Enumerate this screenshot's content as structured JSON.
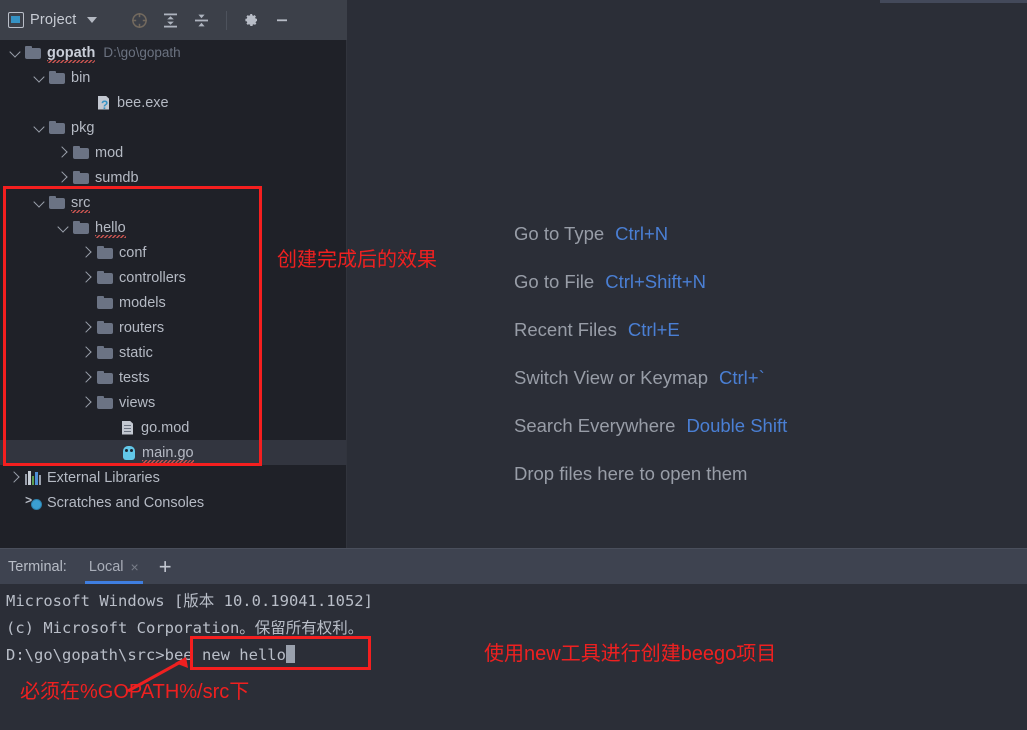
{
  "toolwindow": {
    "title": "Project",
    "icons": [
      {
        "name": "project-view-icon",
        "glyph": "project"
      },
      {
        "name": "dropdown-caret-icon",
        "glyph": "caret-down"
      },
      {
        "name": "scroll-from-source-icon",
        "glyph": "crosshair-target"
      },
      {
        "name": "expand-all-icon",
        "glyph": "expand-all"
      },
      {
        "name": "collapse-all-icon",
        "glyph": "collapse-all"
      },
      {
        "name": "settings-gear-icon",
        "glyph": "gear"
      },
      {
        "name": "hide-toolwindow-icon",
        "glyph": "minus"
      }
    ]
  },
  "tree": {
    "nodes": [
      {
        "label": "gopath",
        "path": "D:\\go\\gopath",
        "indent": 0,
        "toggle": "open",
        "icon": "folder",
        "bold": true,
        "squiggle": true,
        "selected": false
      },
      {
        "label": "bin",
        "path": "",
        "indent": 1,
        "toggle": "open",
        "icon": "folder",
        "bold": false,
        "squiggle": false,
        "selected": false
      },
      {
        "label": "bee.exe",
        "path": "",
        "indent": 3,
        "toggle": "none",
        "icon": "exe",
        "bold": false,
        "squiggle": false,
        "selected": false
      },
      {
        "label": "pkg",
        "path": "",
        "indent": 1,
        "toggle": "open",
        "icon": "folder",
        "bold": false,
        "squiggle": false,
        "selected": false
      },
      {
        "label": "mod",
        "path": "",
        "indent": 2,
        "toggle": "closed",
        "icon": "folder",
        "bold": false,
        "squiggle": false,
        "selected": false
      },
      {
        "label": "sumdb",
        "path": "",
        "indent": 2,
        "toggle": "closed",
        "icon": "folder",
        "bold": false,
        "squiggle": false,
        "selected": false
      },
      {
        "label": "src",
        "path": "",
        "indent": 1,
        "toggle": "open",
        "icon": "folder",
        "bold": false,
        "squiggle": true,
        "selected": false
      },
      {
        "label": "hello",
        "path": "",
        "indent": 2,
        "toggle": "open",
        "icon": "folder",
        "bold": false,
        "squiggle": true,
        "selected": false
      },
      {
        "label": "conf",
        "path": "",
        "indent": 3,
        "toggle": "closed",
        "icon": "folder",
        "bold": false,
        "squiggle": false,
        "selected": false
      },
      {
        "label": "controllers",
        "path": "",
        "indent": 3,
        "toggle": "closed",
        "icon": "folder",
        "bold": false,
        "squiggle": false,
        "selected": false
      },
      {
        "label": "models",
        "path": "",
        "indent": 3,
        "toggle": "none",
        "icon": "folder",
        "bold": false,
        "squiggle": false,
        "selected": false
      },
      {
        "label": "routers",
        "path": "",
        "indent": 3,
        "toggle": "closed",
        "icon": "folder",
        "bold": false,
        "squiggle": false,
        "selected": false
      },
      {
        "label": "static",
        "path": "",
        "indent": 3,
        "toggle": "closed",
        "icon": "folder",
        "bold": false,
        "squiggle": false,
        "selected": false
      },
      {
        "label": "tests",
        "path": "",
        "indent": 3,
        "toggle": "closed",
        "icon": "folder",
        "bold": false,
        "squiggle": false,
        "selected": false
      },
      {
        "label": "views",
        "path": "",
        "indent": 3,
        "toggle": "closed",
        "icon": "folder",
        "bold": false,
        "squiggle": false,
        "selected": false
      },
      {
        "label": "go.mod",
        "path": "",
        "indent": 4,
        "toggle": "none",
        "icon": "doc",
        "bold": false,
        "squiggle": false,
        "selected": false
      },
      {
        "label": "main.go",
        "path": "",
        "indent": 4,
        "toggle": "none",
        "icon": "gopher",
        "bold": false,
        "squiggle": true,
        "selected": true
      },
      {
        "label": "External Libraries",
        "path": "",
        "indent": 0,
        "toggle": "closed",
        "icon": "library",
        "bold": false,
        "squiggle": false,
        "selected": false
      },
      {
        "label": "Scratches and Consoles",
        "path": "",
        "indent": 0,
        "toggle": "none",
        "icon": "scratch",
        "bold": false,
        "squiggle": false,
        "selected": false
      }
    ]
  },
  "editor_hints": [
    {
      "action": "Go to Type",
      "key": "Ctrl+N"
    },
    {
      "action": "Go to File",
      "key": "Ctrl+Shift+N"
    },
    {
      "action": "Recent Files",
      "key": "Ctrl+E"
    },
    {
      "action": "Switch View or Keymap",
      "key": "Ctrl+`"
    },
    {
      "action": "Search Everywhere",
      "key": "Double Shift"
    },
    {
      "action": "Drop files here to open them",
      "key": ""
    }
  ],
  "terminal": {
    "label": "Terminal:",
    "tab_name": "Local",
    "tab_close": "×",
    "add_tab": "+",
    "lines": [
      "Microsoft Windows [版本 10.0.19041.1052]",
      "(c) Microsoft Corporation。保留所有权利。"
    ],
    "prompt": "D:\\go\\gopath\\src>",
    "command": "bee new hello"
  },
  "annotations": {
    "tree_note": "创建完成后的效果",
    "command_note": "使用new工具进行创建beego项目",
    "src_note": "必须在%GOPATH%/src下"
  },
  "colors": {
    "annotation_red": "#ef2020",
    "shortcut_blue": "#4a7fd4",
    "tab_underline": "#3f7ee0",
    "panel_bg": "#1f2128",
    "editor_bg": "#2b2e37",
    "header_bg": "#3c4049",
    "terminal_header_bg": "#3e4350"
  }
}
